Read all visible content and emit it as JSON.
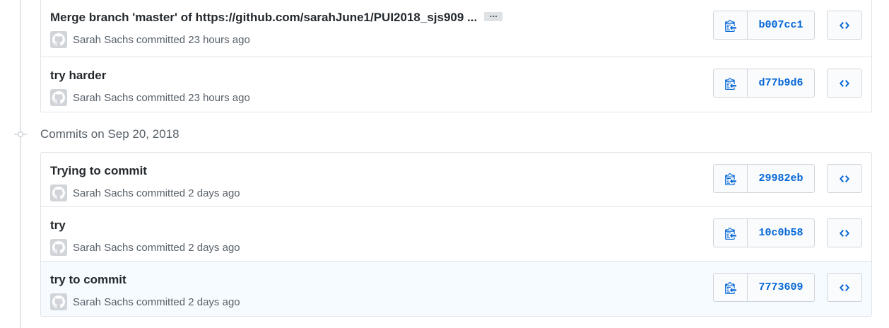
{
  "groups": [
    {
      "heading": "",
      "commits": [
        {
          "message": "Merge branch 'master' of https://github.com/sarahJune1/PUI2018_sjs909 ...",
          "ellipsis": "…",
          "author": "Sarah Sachs",
          "committed": "committed 23 hours ago",
          "sha": "b007cc1"
        },
        {
          "message": "try harder",
          "author": "Sarah Sachs",
          "committed": "committed 23 hours ago",
          "sha": "d77b9d6"
        }
      ]
    },
    {
      "heading": "Commits on Sep 20, 2018",
      "commits": [
        {
          "message": "Trying to commit",
          "author": "Sarah Sachs",
          "committed": "committed 2 days ago",
          "sha": "29982eb"
        },
        {
          "message": "try",
          "author": "Sarah Sachs",
          "committed": "committed 2 days ago",
          "sha": "10c0b58"
        },
        {
          "message": "try to commit",
          "author": "Sarah Sachs",
          "committed": "committed 2 days ago",
          "sha": "7773609"
        }
      ]
    }
  ],
  "icons": {
    "avatar": "octocat-icon",
    "copy": "clipboard-icon",
    "browse": "code-icon",
    "timeline": "git-commit-icon"
  },
  "colors": {
    "sha_link": "#0366d6",
    "highlight_row": "#f6fbff",
    "border": "#e1e4e8"
  }
}
